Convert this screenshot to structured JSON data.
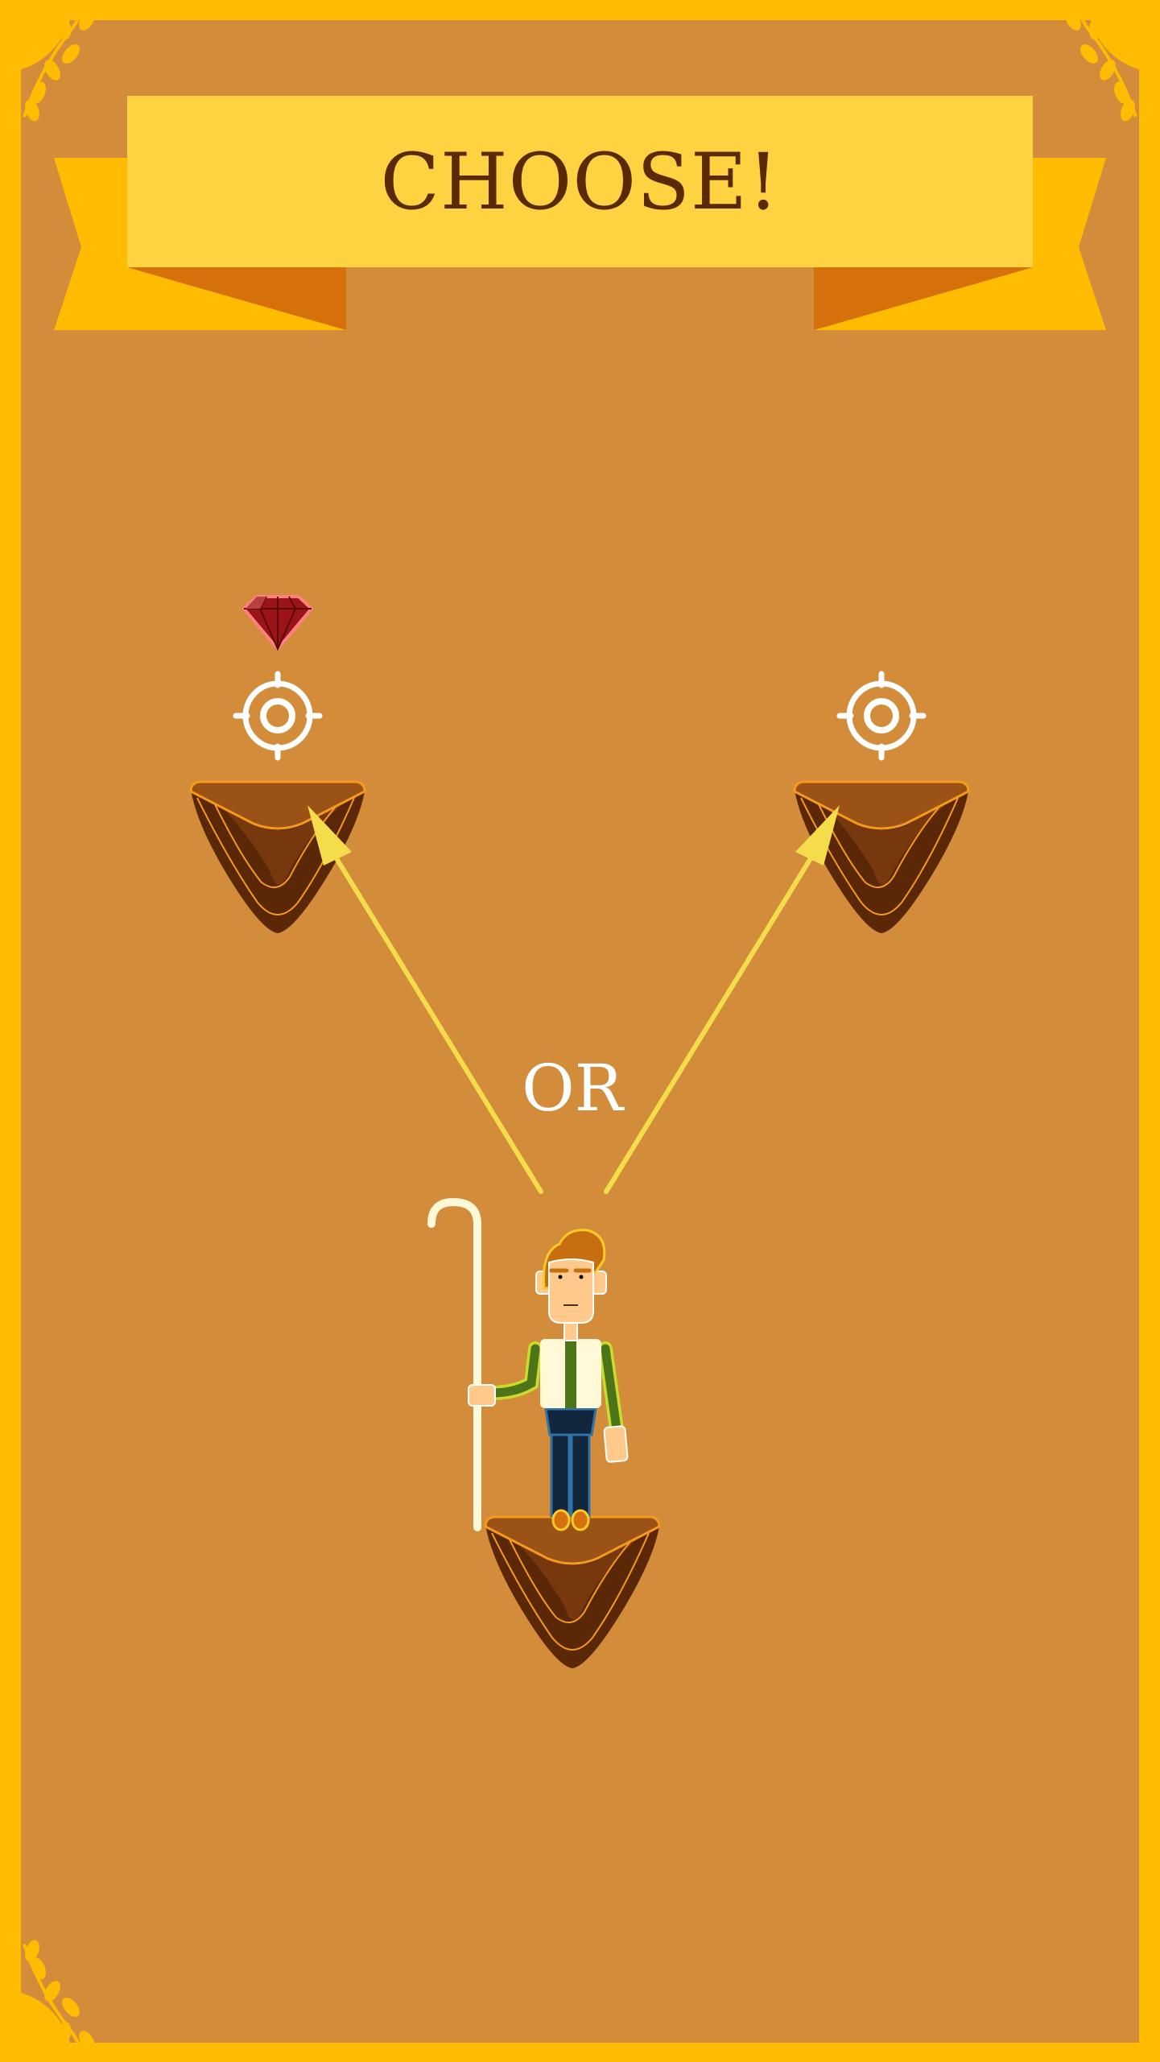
{
  "title": "CHOOSE!",
  "separator": "OR",
  "options": [
    {
      "name": "left-platform",
      "reward": "ruby-gem",
      "marker": "target-icon"
    },
    {
      "name": "right-platform",
      "reward": null,
      "marker": "target-icon"
    }
  ],
  "colors": {
    "background": "#D38C3A",
    "frame": "#FFBC00",
    "banner": "#FFD242",
    "banner_shadow": "#D6700A",
    "title_text": "#5A2A05",
    "arrow": "#F4DC4A",
    "platform_top": "#9A5216",
    "platform_body": "#5A2806"
  }
}
